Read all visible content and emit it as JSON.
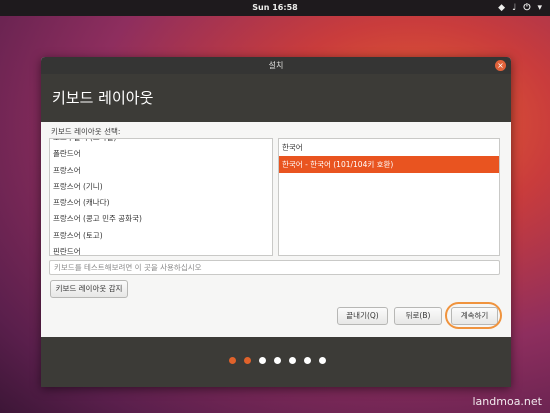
{
  "top_panel": {
    "clock": "Sun 16:58"
  },
  "window": {
    "title": "설치",
    "close_label": "×",
    "header_title": "키보드 레이아웃",
    "section_label": "키보드 레이아웃 선택:",
    "layouts_left": [
      "포르투갈어 (브라질)",
      "폴란드어",
      "프랑스어",
      "프랑스어 (기니)",
      "프랑스어 (캐나다)",
      "프랑스어 (콩고 민주 공화국)",
      "프랑스어 (토고)",
      "핀란드어"
    ],
    "layouts_right": [
      "한국어",
      "한국어 - 한국어 (101/104키 호환)"
    ],
    "selected_right_index": 1,
    "test_placeholder": "키보드를 테스트해보려면 이 곳을 사용하십시오",
    "detect_button": "키보드 레이아웃 감지",
    "quit_button": "끝내기(Q)",
    "back_button": "뒤로(B)",
    "continue_button": "계속하기",
    "progress": {
      "total_steps": 7,
      "current_step": 2
    }
  },
  "colors": {
    "accent": "#e95420",
    "header": "#3c3b37"
  },
  "watermark": "landmoa.net"
}
